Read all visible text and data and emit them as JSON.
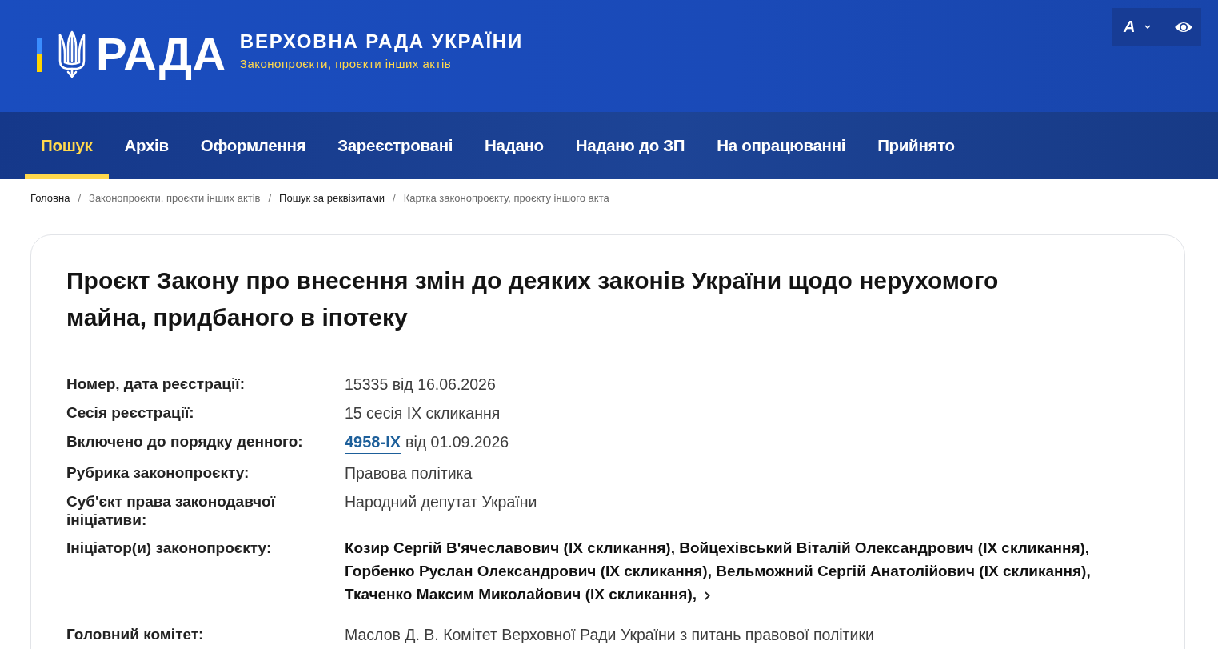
{
  "header": {
    "logo_text": "РАДА",
    "title": "ВЕРХОВНА РАДА УКРАЇНИ",
    "subtitle": "Законопроєкти, проєкти інших актів",
    "font_button": "A"
  },
  "nav": [
    {
      "label": "Пошук",
      "selected": true
    },
    {
      "label": "Архів",
      "selected": false
    },
    {
      "label": "Оформлення",
      "selected": false
    },
    {
      "label": "Зареєстровані",
      "selected": false
    },
    {
      "label": "Надано",
      "selected": false
    },
    {
      "label": "Надано до ЗП",
      "selected": false
    },
    {
      "label": "На опрацюванні",
      "selected": false
    },
    {
      "label": "Прийнято",
      "selected": false
    }
  ],
  "breadcrumbs": [
    {
      "label": "Головна",
      "kind": "link"
    },
    {
      "separator": "/",
      "label": "Законопроєкти, проєкти інших актів",
      "kind": "muted"
    },
    {
      "separator": "/",
      "label": "Пошук за реквізитами",
      "kind": "link"
    },
    {
      "separator": "/",
      "label": "Картка законопроєкту, проєкту іншого акта",
      "kind": "muted"
    }
  ],
  "card": {
    "title": "Проєкт Закону про внесення змін до деяких законів України щодо нерухомого майна, придбаного в іпотеку",
    "fields": [
      {
        "label": "Номер, дата реєстрації:",
        "kind": "text",
        "value": "15335 від 16.06.2026"
      },
      {
        "label": "Сесія реєстрації:",
        "kind": "text",
        "value": "15 сесія IX скликання"
      },
      {
        "label": "Включено до порядку денного:",
        "kind": "link",
        "link": "4958-IX",
        "value": "від 01.09.2026"
      },
      {
        "label": "Рубрика законопроєкту:",
        "kind": "text",
        "value": "Правова політика"
      },
      {
        "label": "Суб'єкт права законодавчої ініціативи:",
        "kind": "text",
        "value": "Народний депутат України"
      },
      {
        "label": "Ініціатор(и) законопроєкту:",
        "kind": "people",
        "people": [
          "Козир Сергій В'ячеславович (IX скликання),",
          "Войцехівський Віталій Олександрович (IX скликання),",
          "Горбенко Руслан Олександрович (IX скликання),",
          "Вельможний Сергій Анатолійович (IX скликання),",
          "Ткаченко Максим Миколайович (IX скликання),"
        ]
      },
      {
        "label": "Головний комітет:",
        "kind": "text",
        "value": "Маслов Д. В. Комітет Верховної Ради України з питань правової політики"
      }
    ]
  }
}
